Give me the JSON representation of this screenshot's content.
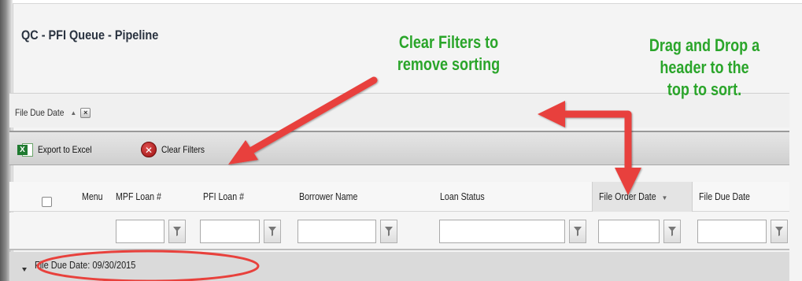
{
  "page": {
    "title": "QC - PFI Queue - Pipeline"
  },
  "group_area": {
    "chip_label": "File Due Date",
    "remove_icon": "close-icon"
  },
  "toolbar": {
    "export_label": "Export to Excel",
    "clear_label": "Clear Filters",
    "export_icon": "excel-icon",
    "clear_icon": "clear-circle-icon"
  },
  "columns": [
    {
      "key": "menu",
      "label": "Menu"
    },
    {
      "key": "mpf_loan",
      "label": "MPF Loan #"
    },
    {
      "key": "pfi_loan",
      "label": "PFI Loan #"
    },
    {
      "key": "borrower_name",
      "label": "Borrower Name"
    },
    {
      "key": "loan_status",
      "label": "Loan Status"
    },
    {
      "key": "file_order_date",
      "label": "File Order Date"
    },
    {
      "key": "file_due_date",
      "label": "File Due Date"
    }
  ],
  "filters": {
    "mpf_loan": "",
    "pfi_loan": "",
    "borrower_name": "",
    "loan_status": "",
    "file_order_date": "",
    "file_due_date": ""
  },
  "group_row": {
    "label": "File Due Date: 09/30/2015"
  },
  "annotations": {
    "clear_line1": "Clear Filters to",
    "clear_line2": "remove sorting",
    "drag_line1": "Drag and Drop a",
    "drag_line2": "header to the",
    "drag_line3": "top to sort."
  },
  "colors": {
    "annotation_text": "#2aa52a",
    "annotation_arrow": "#e8413c",
    "title_text": "#2a3340"
  }
}
